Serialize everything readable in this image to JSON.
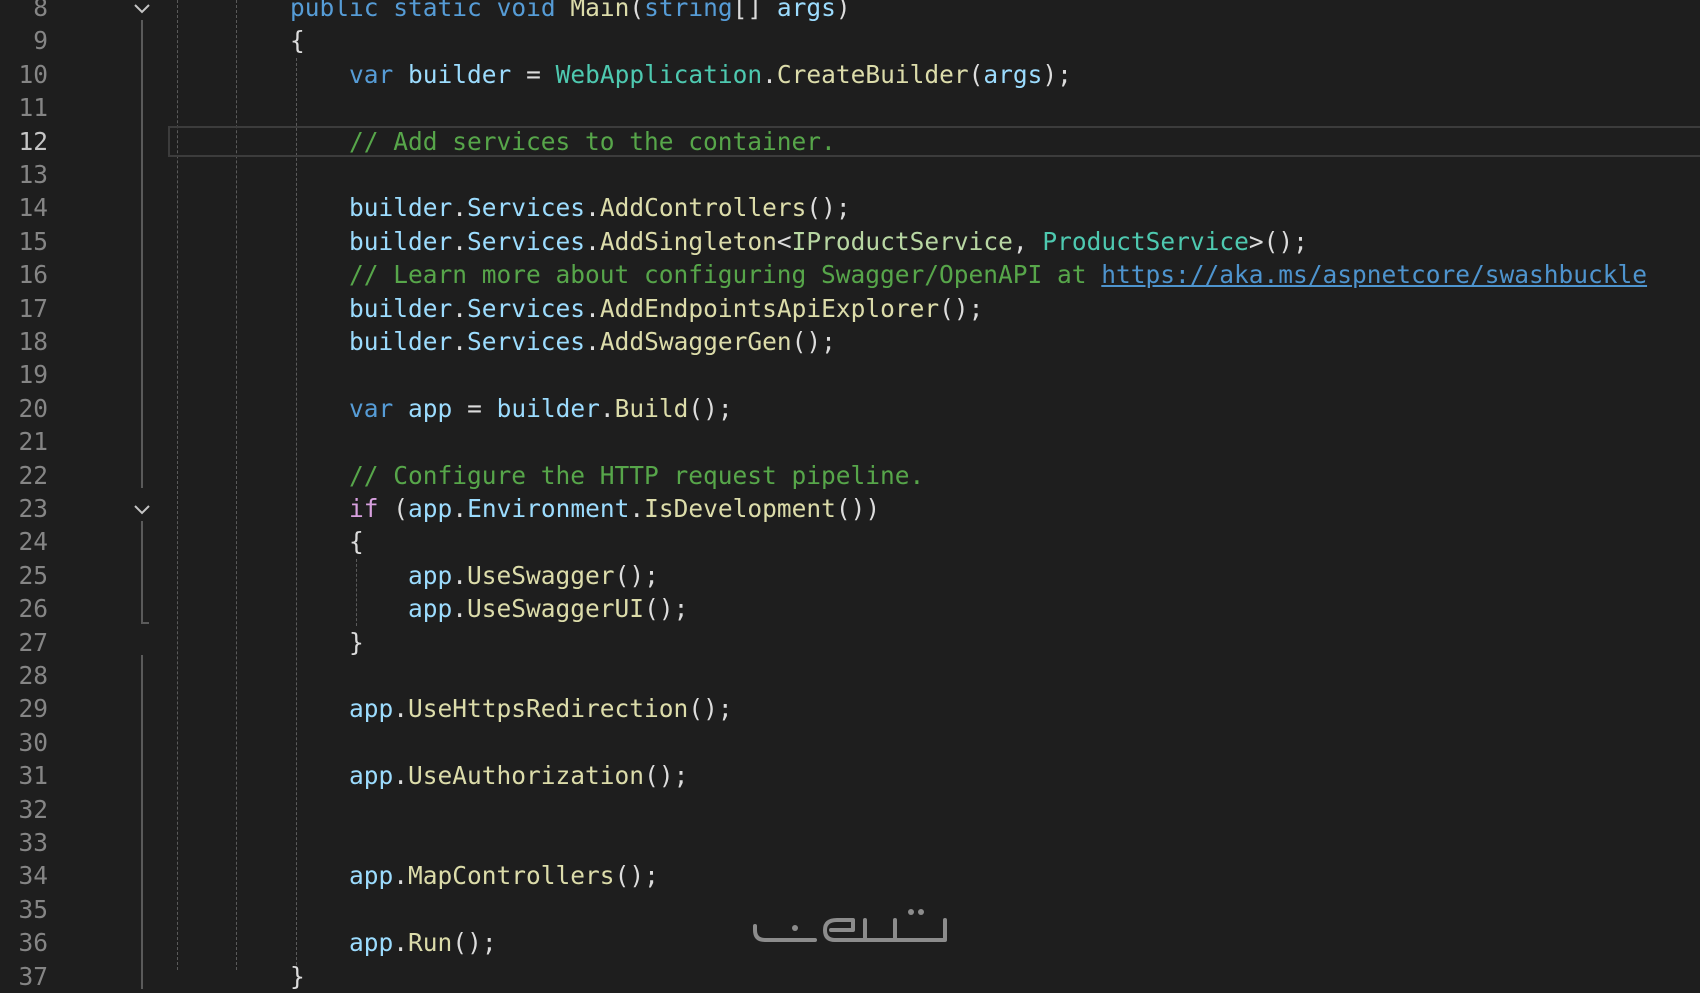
{
  "editor": {
    "language": "C#",
    "current_line": "12",
    "colors": {
      "background": "#1e1e1e",
      "keyword": "#569cd6",
      "control_keyword": "#d8a0df",
      "type": "#4ec9b0",
      "method": "#dcdcaa",
      "variable": "#9cdcfe",
      "comment": "#57a64a",
      "link": "#4e94ce"
    },
    "lines": [
      {
        "number": "8",
        "tokens": [
          {
            "t": "public",
            "c": "kw"
          },
          {
            "t": " ",
            "c": "punc"
          },
          {
            "t": "static",
            "c": "kw"
          },
          {
            "t": " ",
            "c": "punc"
          },
          {
            "t": "void",
            "c": "kw"
          },
          {
            "t": " ",
            "c": "punc"
          },
          {
            "t": "Main",
            "c": "method"
          },
          {
            "t": "(",
            "c": "punc"
          },
          {
            "t": "string",
            "c": "kw"
          },
          {
            "t": "[] ",
            "c": "punc"
          },
          {
            "t": "args",
            "c": "var"
          },
          {
            "t": ")",
            "c": "punc"
          }
        ]
      },
      {
        "number": "9",
        "tokens": [
          {
            "t": "{",
            "c": "punc"
          }
        ]
      },
      {
        "number": "10",
        "tokens": [
          {
            "t": "    ",
            "c": "punc"
          },
          {
            "t": "var",
            "c": "kw"
          },
          {
            "t": " ",
            "c": "punc"
          },
          {
            "t": "builder",
            "c": "var"
          },
          {
            "t": " = ",
            "c": "punc"
          },
          {
            "t": "WebApplication",
            "c": "type"
          },
          {
            "t": ".",
            "c": "punc"
          },
          {
            "t": "CreateBuilder",
            "c": "method"
          },
          {
            "t": "(",
            "c": "punc"
          },
          {
            "t": "args",
            "c": "var"
          },
          {
            "t": ");",
            "c": "punc"
          }
        ]
      },
      {
        "number": "11",
        "tokens": []
      },
      {
        "number": "12",
        "tokens": [
          {
            "t": "    ",
            "c": "punc"
          },
          {
            "t": "// Add services to the container.",
            "c": "cmt"
          }
        ]
      },
      {
        "number": "13",
        "tokens": []
      },
      {
        "number": "14",
        "tokens": [
          {
            "t": "    ",
            "c": "punc"
          },
          {
            "t": "builder",
            "c": "var"
          },
          {
            "t": ".",
            "c": "punc"
          },
          {
            "t": "Services",
            "c": "var"
          },
          {
            "t": ".",
            "c": "punc"
          },
          {
            "t": "AddControllers",
            "c": "method"
          },
          {
            "t": "();",
            "c": "punc"
          }
        ]
      },
      {
        "number": "15",
        "tokens": [
          {
            "t": "    ",
            "c": "punc"
          },
          {
            "t": "builder",
            "c": "var"
          },
          {
            "t": ".",
            "c": "punc"
          },
          {
            "t": "Services",
            "c": "var"
          },
          {
            "t": ".",
            "c": "punc"
          },
          {
            "t": "AddSingleton",
            "c": "method"
          },
          {
            "t": "<",
            "c": "punc"
          },
          {
            "t": "IProductService",
            "c": "iface"
          },
          {
            "t": ", ",
            "c": "punc"
          },
          {
            "t": "ProductService",
            "c": "type"
          },
          {
            "t": ">();",
            "c": "punc"
          }
        ]
      },
      {
        "number": "16",
        "tokens": [
          {
            "t": "    ",
            "c": "punc"
          },
          {
            "t": "// Learn more about configuring Swagger/OpenAPI at ",
            "c": "cmt"
          },
          {
            "t": "https://aka.ms/aspnetcore/swashbuckle",
            "c": "link"
          }
        ]
      },
      {
        "number": "17",
        "tokens": [
          {
            "t": "    ",
            "c": "punc"
          },
          {
            "t": "builder",
            "c": "var"
          },
          {
            "t": ".",
            "c": "punc"
          },
          {
            "t": "Services",
            "c": "var"
          },
          {
            "t": ".",
            "c": "punc"
          },
          {
            "t": "AddEndpointsApiExplorer",
            "c": "method"
          },
          {
            "t": "();",
            "c": "punc"
          }
        ]
      },
      {
        "number": "18",
        "tokens": [
          {
            "t": "    ",
            "c": "punc"
          },
          {
            "t": "builder",
            "c": "var"
          },
          {
            "t": ".",
            "c": "punc"
          },
          {
            "t": "Services",
            "c": "var"
          },
          {
            "t": ".",
            "c": "punc"
          },
          {
            "t": "AddSwaggerGen",
            "c": "method"
          },
          {
            "t": "();",
            "c": "punc"
          }
        ]
      },
      {
        "number": "19",
        "tokens": []
      },
      {
        "number": "20",
        "tokens": [
          {
            "t": "    ",
            "c": "punc"
          },
          {
            "t": "var",
            "c": "kw"
          },
          {
            "t": " ",
            "c": "punc"
          },
          {
            "t": "app",
            "c": "var"
          },
          {
            "t": " = ",
            "c": "punc"
          },
          {
            "t": "builder",
            "c": "var"
          },
          {
            "t": ".",
            "c": "punc"
          },
          {
            "t": "Build",
            "c": "method"
          },
          {
            "t": "();",
            "c": "punc"
          }
        ]
      },
      {
        "number": "21",
        "tokens": []
      },
      {
        "number": "22",
        "tokens": [
          {
            "t": "    ",
            "c": "punc"
          },
          {
            "t": "// Configure the HTTP request pipeline.",
            "c": "cmt"
          }
        ]
      },
      {
        "number": "23",
        "tokens": [
          {
            "t": "    ",
            "c": "punc"
          },
          {
            "t": "if",
            "c": "ctrl"
          },
          {
            "t": " (",
            "c": "punc"
          },
          {
            "t": "app",
            "c": "var"
          },
          {
            "t": ".",
            "c": "punc"
          },
          {
            "t": "Environment",
            "c": "var"
          },
          {
            "t": ".",
            "c": "punc"
          },
          {
            "t": "IsDevelopment",
            "c": "method"
          },
          {
            "t": "())",
            "c": "punc"
          }
        ]
      },
      {
        "number": "24",
        "tokens": [
          {
            "t": "    {",
            "c": "punc"
          }
        ]
      },
      {
        "number": "25",
        "tokens": [
          {
            "t": "        ",
            "c": "punc"
          },
          {
            "t": "app",
            "c": "var"
          },
          {
            "t": ".",
            "c": "punc"
          },
          {
            "t": "UseSwagger",
            "c": "method"
          },
          {
            "t": "();",
            "c": "punc"
          }
        ]
      },
      {
        "number": "26",
        "tokens": [
          {
            "t": "        ",
            "c": "punc"
          },
          {
            "t": "app",
            "c": "var"
          },
          {
            "t": ".",
            "c": "punc"
          },
          {
            "t": "UseSwaggerUI",
            "c": "method"
          },
          {
            "t": "();",
            "c": "punc"
          }
        ]
      },
      {
        "number": "27",
        "tokens": [
          {
            "t": "    }",
            "c": "punc"
          }
        ]
      },
      {
        "number": "28",
        "tokens": []
      },
      {
        "number": "29",
        "tokens": [
          {
            "t": "    ",
            "c": "punc"
          },
          {
            "t": "app",
            "c": "var"
          },
          {
            "t": ".",
            "c": "punc"
          },
          {
            "t": "UseHttpsRedirection",
            "c": "method"
          },
          {
            "t": "();",
            "c": "punc"
          }
        ]
      },
      {
        "number": "30",
        "tokens": []
      },
      {
        "number": "31",
        "tokens": [
          {
            "t": "    ",
            "c": "punc"
          },
          {
            "t": "app",
            "c": "var"
          },
          {
            "t": ".",
            "c": "punc"
          },
          {
            "t": "UseAuthorization",
            "c": "method"
          },
          {
            "t": "();",
            "c": "punc"
          }
        ]
      },
      {
        "number": "32",
        "tokens": []
      },
      {
        "number": "33",
        "tokens": []
      },
      {
        "number": "34",
        "tokens": [
          {
            "t": "    ",
            "c": "punc"
          },
          {
            "t": "app",
            "c": "var"
          },
          {
            "t": ".",
            "c": "punc"
          },
          {
            "t": "MapControllers",
            "c": "method"
          },
          {
            "t": "();",
            "c": "punc"
          }
        ]
      },
      {
        "number": "35",
        "tokens": []
      },
      {
        "number": "36",
        "tokens": [
          {
            "t": "    ",
            "c": "punc"
          },
          {
            "t": "app",
            "c": "var"
          },
          {
            "t": ".",
            "c": "punc"
          },
          {
            "t": "Run",
            "c": "method"
          },
          {
            "t": "();",
            "c": "punc"
          }
        ]
      },
      {
        "number": "37",
        "tokens": [
          {
            "t": "}",
            "c": "punc"
          }
        ]
      }
    ],
    "fold_icons": [
      {
        "line": "8",
        "icon": "chevron-down-icon"
      },
      {
        "line": "23",
        "icon": "chevron-down-icon"
      }
    ]
  },
  "watermark": {
    "text": "خمسات",
    "icon": "khamsat-logo"
  }
}
